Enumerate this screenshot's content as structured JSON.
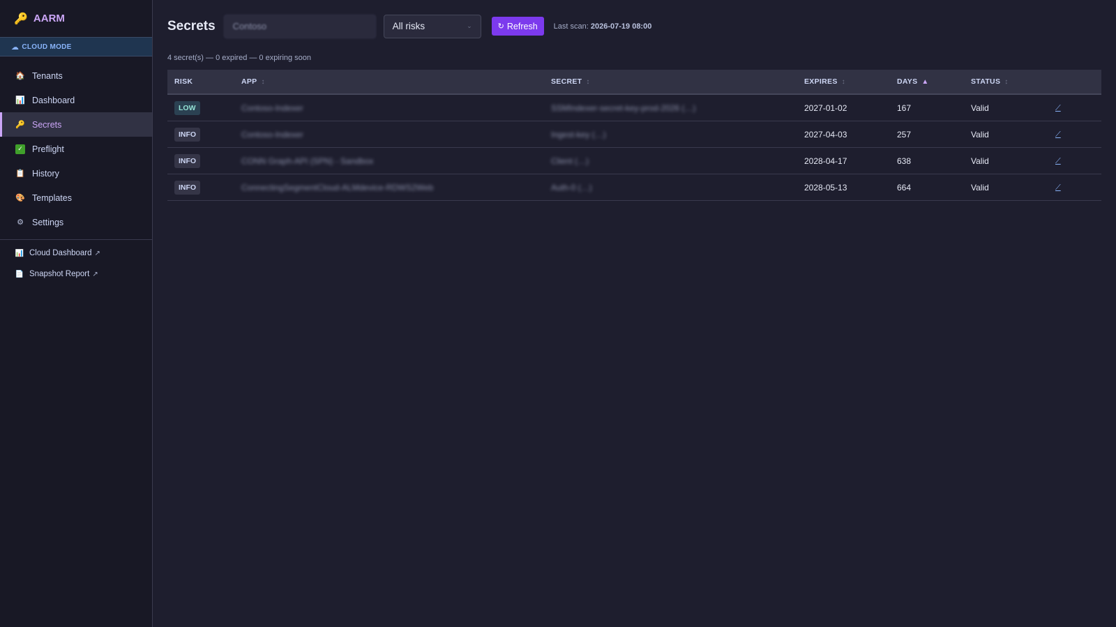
{
  "app": {
    "title": "AARM",
    "mode": "CLOUD MODE"
  },
  "sidebar": {
    "items": [
      {
        "label": "Tenants",
        "icon": "house-icon"
      },
      {
        "label": "Dashboard",
        "icon": "chart-icon"
      },
      {
        "label": "Secrets",
        "icon": "key-icon",
        "active": true
      },
      {
        "label": "Preflight",
        "icon": "check-icon"
      },
      {
        "label": "History",
        "icon": "clipboard-icon"
      },
      {
        "label": "Templates",
        "icon": "palette-icon"
      },
      {
        "label": "Settings",
        "icon": "gear-icon"
      }
    ],
    "external": [
      {
        "label": "Cloud Dashboard",
        "icon": "chart-icon",
        "arrow": "↗"
      },
      {
        "label": "Snapshot Report",
        "icon": "document-icon",
        "arrow": "↗"
      }
    ]
  },
  "header": {
    "title": "Secrets",
    "search_value": "Contoso",
    "risk_filter": "All risks",
    "refresh_label": "Refresh",
    "last_scan_label": "Last scan:",
    "last_scan_value": "2026-07-19 08:00"
  },
  "summary": "4 secret(s) — 0 expired — 0 expiring soon",
  "table": {
    "columns": [
      "RISK",
      "APP",
      "SECRET",
      "EXPIRES",
      "DAYS",
      "STATUS"
    ],
    "sorted_column": "DAYS",
    "rows": [
      {
        "risk": "LOW",
        "app": "Contoso-Indexer",
        "secret": "SSMIndexer-secret-key-prod-2026 (…)",
        "expires": "2027-01-02",
        "days": "167",
        "status": "Valid"
      },
      {
        "risk": "INFO",
        "app": "Contoso-Indexer",
        "secret": "Ingest-key (…)",
        "expires": "2027-04-03",
        "days": "257",
        "status": "Valid"
      },
      {
        "risk": "INFO",
        "app": "CONN Graph-API (SPN) - Sandbox",
        "secret": "Client (…)",
        "expires": "2028-04-17",
        "days": "638",
        "status": "Valid"
      },
      {
        "risk": "INFO",
        "app": "ConnectingSegmentCloud-ALMdevice-RDWS2Web",
        "secret": "Auth-0 (…)",
        "expires": "2028-05-13",
        "days": "664",
        "status": "Valid"
      }
    ]
  },
  "colors": {
    "accent": "#cba6f7",
    "button": "#7c3aed",
    "background": "#1e1e2e",
    "sidebar": "#181825"
  }
}
